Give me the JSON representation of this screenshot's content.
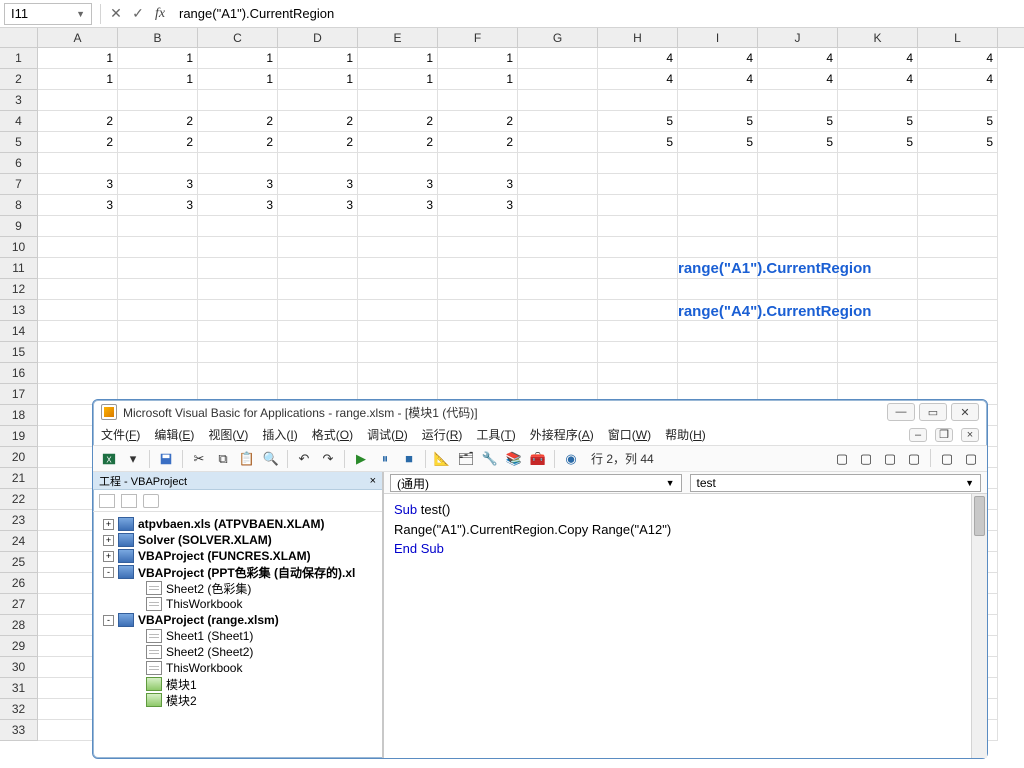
{
  "nameBox": {
    "value": "I11"
  },
  "formula": {
    "value": "range(\"A1\").CurrentRegion"
  },
  "columns": [
    "A",
    "B",
    "C",
    "D",
    "E",
    "F",
    "G",
    "H",
    "I",
    "J",
    "K",
    "L"
  ],
  "rowCount": 33,
  "cells": {
    "1": [
      "1",
      "1",
      "1",
      "1",
      "1",
      "1",
      "",
      "4",
      "4",
      "4",
      "4",
      "4"
    ],
    "2": [
      "1",
      "1",
      "1",
      "1",
      "1",
      "1",
      "",
      "4",
      "4",
      "4",
      "4",
      "4"
    ],
    "3": [
      "",
      "",
      "",
      "",
      "",
      "",
      "",
      "",
      "",
      "",
      "",
      ""
    ],
    "4": [
      "2",
      "2",
      "2",
      "2",
      "2",
      "2",
      "",
      "5",
      "5",
      "5",
      "5",
      "5"
    ],
    "5": [
      "2",
      "2",
      "2",
      "2",
      "2",
      "2",
      "",
      "5",
      "5",
      "5",
      "5",
      "5"
    ],
    "6": [
      "",
      "",
      "",
      "",
      "",
      "",
      "",
      "",
      "",
      "",
      "",
      ""
    ],
    "7": [
      "3",
      "3",
      "3",
      "3",
      "3",
      "3",
      "",
      "",
      "",
      "",
      "",
      ""
    ],
    "8": [
      "3",
      "3",
      "3",
      "3",
      "3",
      "3",
      "",
      "",
      "",
      "",
      "",
      ""
    ]
  },
  "annotations": {
    "a1": "range(\"A1\").CurrentRegion",
    "a4": "range(\"A4\").CurrentRegion"
  },
  "vbe": {
    "title": "Microsoft Visual Basic for Applications - range.xlsm - [模块1 (代码)]",
    "menu": [
      "文件(F)",
      "编辑(E)",
      "视图(V)",
      "插入(I)",
      "格式(O)",
      "调试(D)",
      "运行(R)",
      "工具(T)",
      "外接程序(A)",
      "窗口(W)",
      "帮助(H)"
    ],
    "cursorPos": "行 2，列 44",
    "projectTitle": "工程 - VBAProject",
    "tree": [
      {
        "indent": 0,
        "exp": "+",
        "ico": "vba",
        "label": "atpvbaen.xls (ATPVBAEN.XLAM)",
        "bold": true
      },
      {
        "indent": 0,
        "exp": "+",
        "ico": "vba",
        "label": "Solver (SOLVER.XLAM)",
        "bold": true
      },
      {
        "indent": 0,
        "exp": "+",
        "ico": "vba",
        "label": "VBAProject (FUNCRES.XLAM)",
        "bold": true
      },
      {
        "indent": 0,
        "exp": "-",
        "ico": "vba",
        "label": "VBAProject (PPT色彩集 (自动保存的).xl",
        "bold": true
      },
      {
        "indent": 1,
        "exp": "",
        "ico": "sheet",
        "label": "Sheet2 (色彩集)",
        "bold": false
      },
      {
        "indent": 1,
        "exp": "",
        "ico": "sheet",
        "label": "ThisWorkbook",
        "bold": false
      },
      {
        "indent": 0,
        "exp": "-",
        "ico": "vba",
        "label": "VBAProject (range.xlsm)",
        "bold": true
      },
      {
        "indent": 1,
        "exp": "",
        "ico": "sheet",
        "label": "Sheet1 (Sheet1)",
        "bold": false
      },
      {
        "indent": 1,
        "exp": "",
        "ico": "sheet",
        "label": "Sheet2 (Sheet2)",
        "bold": false
      },
      {
        "indent": 1,
        "exp": "",
        "ico": "sheet",
        "label": "ThisWorkbook",
        "bold": false
      },
      {
        "indent": 1,
        "exp": "",
        "ico": "mod",
        "label": "模块1",
        "bold": false
      },
      {
        "indent": 1,
        "exp": "",
        "ico": "mod",
        "label": "模块2",
        "bold": false
      }
    ],
    "comboLeft": "(通用)",
    "comboRight": "test",
    "code": {
      "l1a": "Sub",
      "l1b": " test()",
      "l2": "Range(\"A1\").CurrentRegion.Copy Range(\"A12\")",
      "l3": "End Sub"
    }
  }
}
